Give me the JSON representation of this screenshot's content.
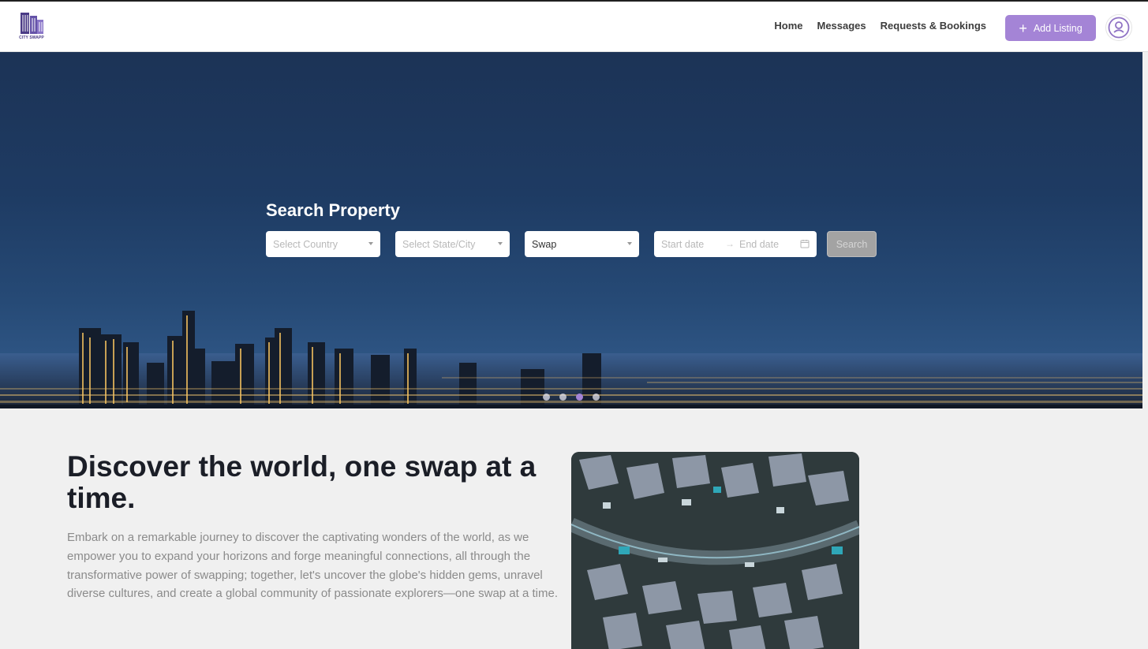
{
  "brand": {
    "name": "CITY SWAPP",
    "accent": "#a484d6"
  },
  "nav": {
    "links": [
      "Home",
      "Messages",
      "Requests & Bookings"
    ],
    "add_listing": "Add Listing"
  },
  "hero": {
    "title": "Search Property",
    "country_placeholder": "Select Country",
    "city_placeholder": "Select State/City",
    "type_value": "Swap",
    "start_placeholder": "Start date",
    "end_placeholder": "End date",
    "search_label": "Search",
    "carousel": {
      "count": 4,
      "active_index": 2
    }
  },
  "content": {
    "headline": "Discover the world, one swap at a time.",
    "paragraph": "Embark on a remarkable journey to discover the captivating wonders of the world, as we empower you to expand your horizons and forge meaningful connections, all through the transformative power of swapping; together, let's uncover the globe's hidden gems, unravel diverse cultures, and create a global community of passionate explorers—one swap at a time."
  }
}
